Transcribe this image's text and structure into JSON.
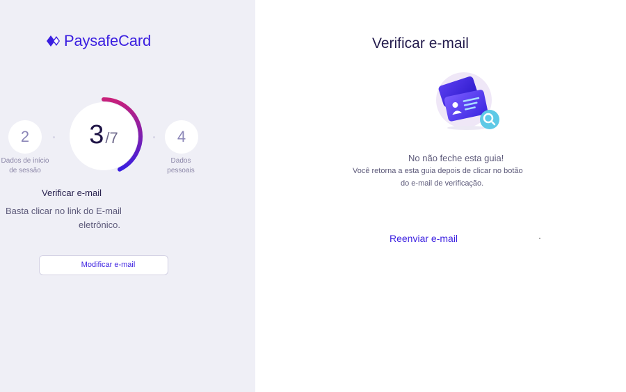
{
  "brand": {
    "name": "PaysafeCard",
    "color": "#3a1ee0"
  },
  "progress": {
    "current": "3",
    "separator": "/",
    "total": "7",
    "fraction": 0.4286,
    "prev_step": {
      "number": "2",
      "caption_line1": "Dados de início",
      "caption_line2": "de sessão"
    },
    "next_step": {
      "number": "4",
      "caption_line1": "Dados",
      "caption_line2": "pessoais"
    }
  },
  "left": {
    "step_title": "Verificar e-mail",
    "description_line1": "Basta clicar no link do E-mail",
    "description_line2": "eletrônico.",
    "modify_button": "Modificar e-mail"
  },
  "right": {
    "title": "Verificar e-mail",
    "warning": "No não feche esta guia!",
    "info_line1": "Você retorna a esta guia depois de clicar no botão",
    "info_line2": "do e-mail de verificação.",
    "resend_button": "Reenviar e-mail",
    "illustration": "email-verification-card-icon"
  },
  "colors": {
    "left_bg": "#efeff6",
    "accent_gradient_start": "#c8207a",
    "accent_gradient_end": "#3a1ee0"
  }
}
